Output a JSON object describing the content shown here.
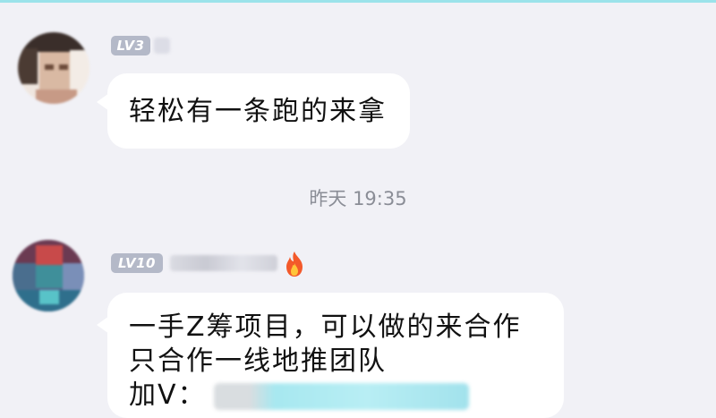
{
  "messages": [
    {
      "sender_level": "LV3",
      "lines": [
        "轻松有一条跑的来拿"
      ]
    },
    {
      "sender_level": "LV10",
      "sender_badge_icon": "fire-icon",
      "lines": [
        "一手Z筹项目，可以做的来合作",
        "只合作一线地推团队",
        "加V："
      ]
    }
  ],
  "timestamp": "昨天 19:35",
  "colors": {
    "background": "#f1f1f6",
    "bubble": "#ffffff",
    "level_badge": "#b4b9c8",
    "timestamp_text": "#8a8d96"
  }
}
